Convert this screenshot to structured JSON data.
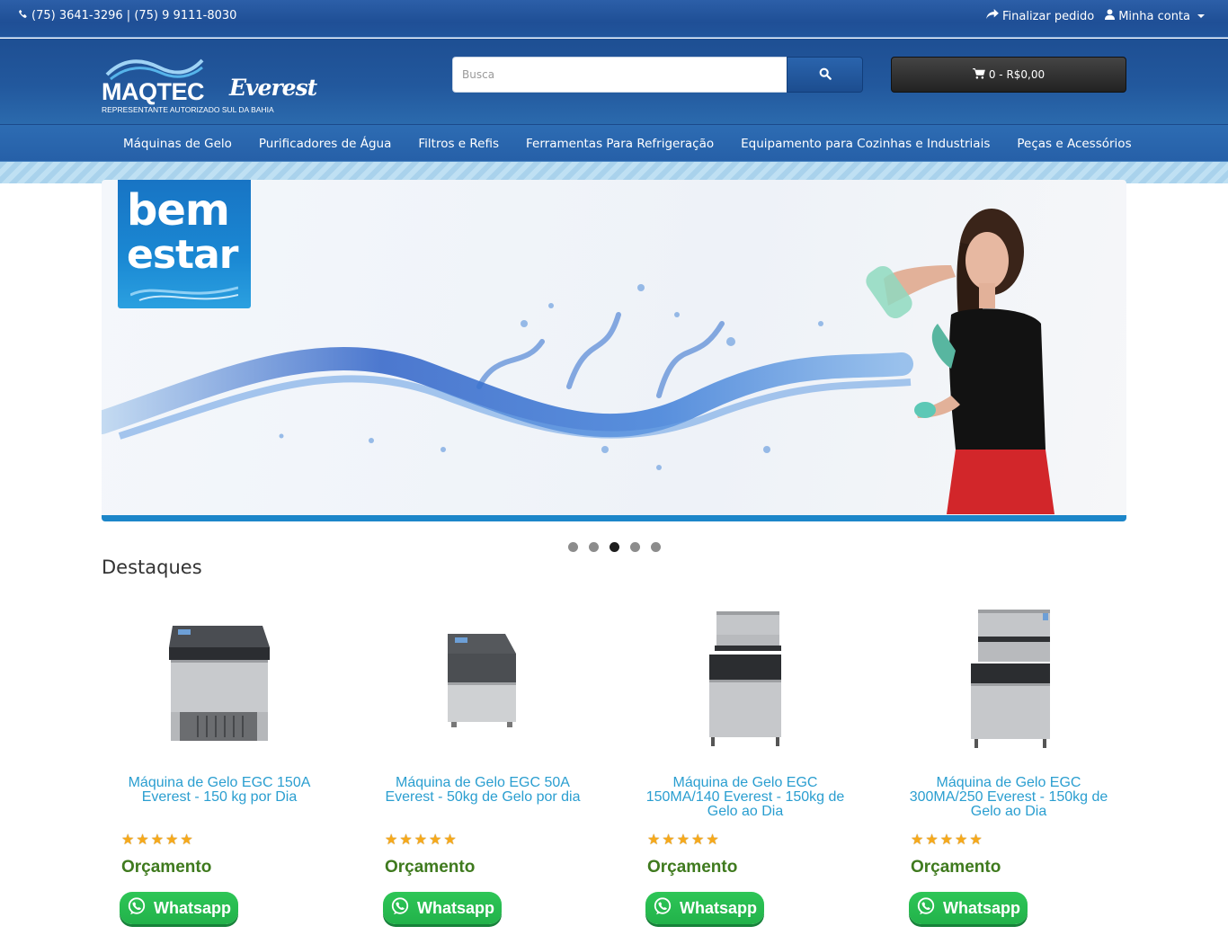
{
  "topbar": {
    "phones": "(75) 3641-3296 | (75) 9 9111-8030",
    "checkout": "Finalizar pedido",
    "account": "Minha conta"
  },
  "header": {
    "logo": {
      "brand": "MAQTEC",
      "partner": "Everest",
      "tagline": "REPRESENTANTE AUTORIZADO SUL DA BAHIA"
    },
    "search": {
      "placeholder": "Busca"
    },
    "cart": {
      "label": "0 - R$0,00"
    }
  },
  "nav": {
    "items": [
      "Máquinas de Gelo",
      "Purificadores de Água",
      "Filtros e Refis",
      "Ferramentas Para Refrigeração",
      "Equipamento para Cozinhas e Industriais",
      "Peças e Acessórios"
    ]
  },
  "banner": {
    "line1": "bem",
    "line2": "estar",
    "slide_count": 5,
    "active_slide": 3
  },
  "featured": {
    "title": "Destaques",
    "products": [
      {
        "name": "Máquina de Gelo EGC 150A Everest - 150 kg por Dia",
        "rating": 5,
        "price": "Orçamento",
        "whatsapp": "Whatsapp"
      },
      {
        "name": "Máquina de Gelo EGC 50A Everest - 50kg de Gelo por dia",
        "rating": 5,
        "price": "Orçamento",
        "whatsapp": "Whatsapp"
      },
      {
        "name": "Máquina de Gelo EGC 150MA/140 Everest - 150kg de Gelo ao Dia",
        "rating": 5,
        "price": "Orçamento",
        "whatsapp": "Whatsapp"
      },
      {
        "name": "Máquina de Gelo EGC 300MA/250 Everest - 150kg de Gelo ao Dia",
        "rating": 5,
        "price": "Orçamento",
        "whatsapp": "Whatsapp"
      }
    ]
  },
  "colors": {
    "primary_blue": "#22589d",
    "link_blue": "#2a9ed0",
    "price_green": "#3f7a1e",
    "whatsapp_green": "#22b24a"
  }
}
